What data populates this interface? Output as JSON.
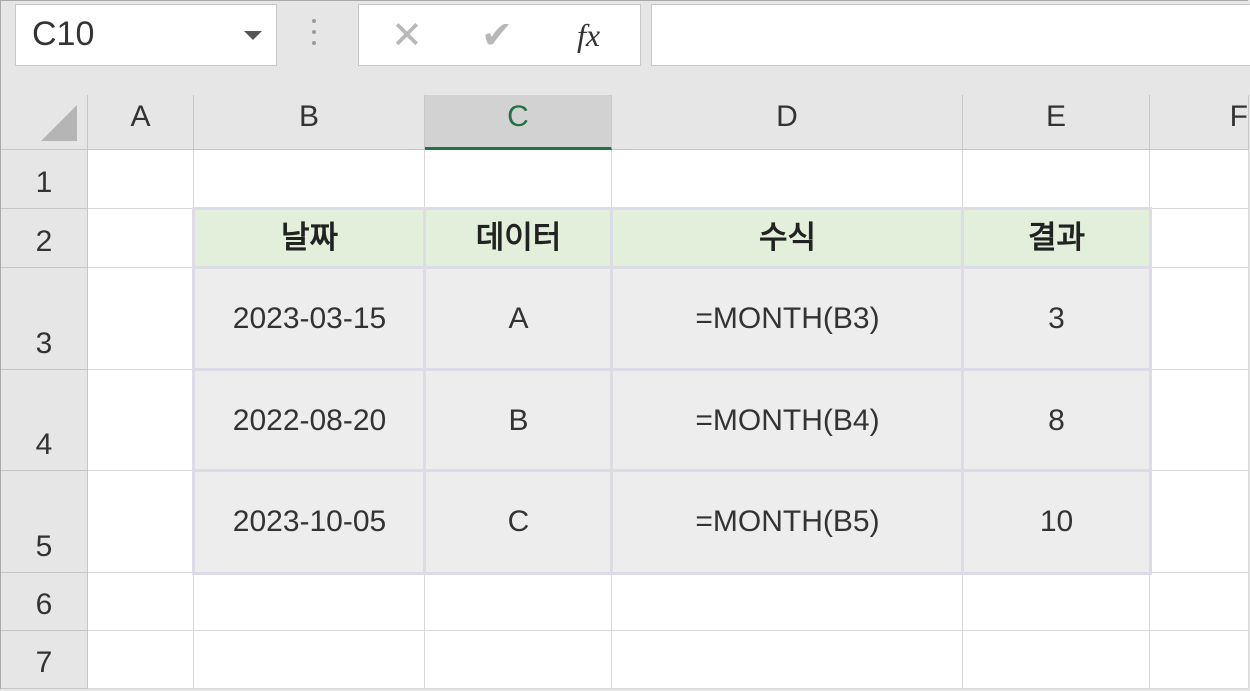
{
  "formula_bar": {
    "name_box": "C10",
    "cancel_glyph": "✕",
    "enter_glyph": "✔",
    "fx_label": "fx",
    "formula": ""
  },
  "columns": [
    "A",
    "B",
    "C",
    "D",
    "E",
    "F"
  ],
  "selected_column": "C",
  "rows": [
    "1",
    "2",
    "3",
    "4",
    "5",
    "6",
    "7"
  ],
  "table": {
    "headers": [
      "날짜",
      "데이터",
      "수식",
      "결과"
    ],
    "rows": [
      [
        "2023-03-15",
        "A",
        "=MONTH(B3)",
        "3"
      ],
      [
        "2022-08-20",
        "B",
        "=MONTH(B4)",
        "8"
      ],
      [
        "2023-10-05",
        "C",
        "=MONTH(B5)",
        "10"
      ]
    ]
  },
  "colors": {
    "header_fill": "#e2efda",
    "body_fill": "#ededed",
    "selected_accent": "#217346"
  }
}
